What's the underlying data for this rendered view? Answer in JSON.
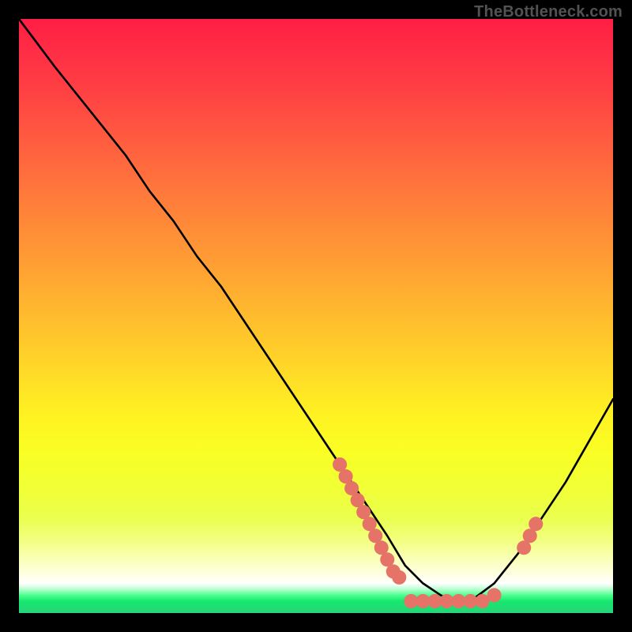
{
  "watermark": "TheBottleneck.com",
  "chart_data": {
    "type": "line",
    "title": "",
    "xlabel": "",
    "ylabel": "",
    "xlim": [
      0,
      100
    ],
    "ylim": [
      0,
      100
    ],
    "grid": false,
    "legend": false,
    "background_gradient": {
      "top": "#ff1e44",
      "mid": "#ffe126",
      "band": "#ffffff",
      "bottom": "#28d47a"
    },
    "curve": {
      "name": "bottleneck-curve",
      "color": "#000000",
      "x": [
        0,
        3,
        6,
        10,
        14,
        18,
        22,
        26,
        30,
        34,
        38,
        42,
        46,
        50,
        54,
        58,
        62,
        65,
        68,
        71,
        73,
        76,
        80,
        84,
        88,
        92,
        96,
        100
      ],
      "y": [
        100,
        96,
        92,
        87,
        82,
        77,
        71,
        66,
        60,
        55,
        49,
        43,
        37,
        31,
        25,
        19,
        13,
        8,
        5,
        3,
        2,
        2,
        5,
        10,
        16,
        22,
        29,
        36
      ]
    },
    "markers": {
      "name": "highlighted-points",
      "color": "#e57368",
      "radius": 1.2,
      "points": [
        {
          "x": 54,
          "y": 25
        },
        {
          "x": 55,
          "y": 23
        },
        {
          "x": 56,
          "y": 21
        },
        {
          "x": 57,
          "y": 19
        },
        {
          "x": 58,
          "y": 17
        },
        {
          "x": 59,
          "y": 15
        },
        {
          "x": 60,
          "y": 13
        },
        {
          "x": 61,
          "y": 11
        },
        {
          "x": 62,
          "y": 9
        },
        {
          "x": 63,
          "y": 7
        },
        {
          "x": 64,
          "y": 6
        },
        {
          "x": 66,
          "y": 2
        },
        {
          "x": 68,
          "y": 2
        },
        {
          "x": 70,
          "y": 2
        },
        {
          "x": 72,
          "y": 2
        },
        {
          "x": 74,
          "y": 2
        },
        {
          "x": 76,
          "y": 2
        },
        {
          "x": 78,
          "y": 2
        },
        {
          "x": 80,
          "y": 3
        },
        {
          "x": 85,
          "y": 11
        },
        {
          "x": 86,
          "y": 13
        },
        {
          "x": 87,
          "y": 15
        }
      ]
    }
  }
}
